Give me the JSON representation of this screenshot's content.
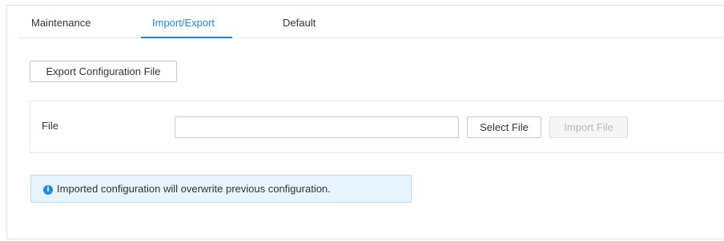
{
  "tabs": [
    {
      "label": "Maintenance",
      "active": false
    },
    {
      "label": "Import/Export",
      "active": true
    },
    {
      "label": "Default",
      "active": false
    }
  ],
  "export": {
    "button_label": "Export Configuration File"
  },
  "file_section": {
    "label": "File",
    "input_value": "",
    "select_button_label": "Select File",
    "import_button_label": "Import File",
    "import_disabled": true
  },
  "notice": {
    "icon": "info-icon",
    "text": "Imported configuration will overwrite previous configuration."
  },
  "colors": {
    "accent": "#1e88e5",
    "notice_background": "#e8f4fd",
    "notice_border": "#b3dbf6"
  }
}
